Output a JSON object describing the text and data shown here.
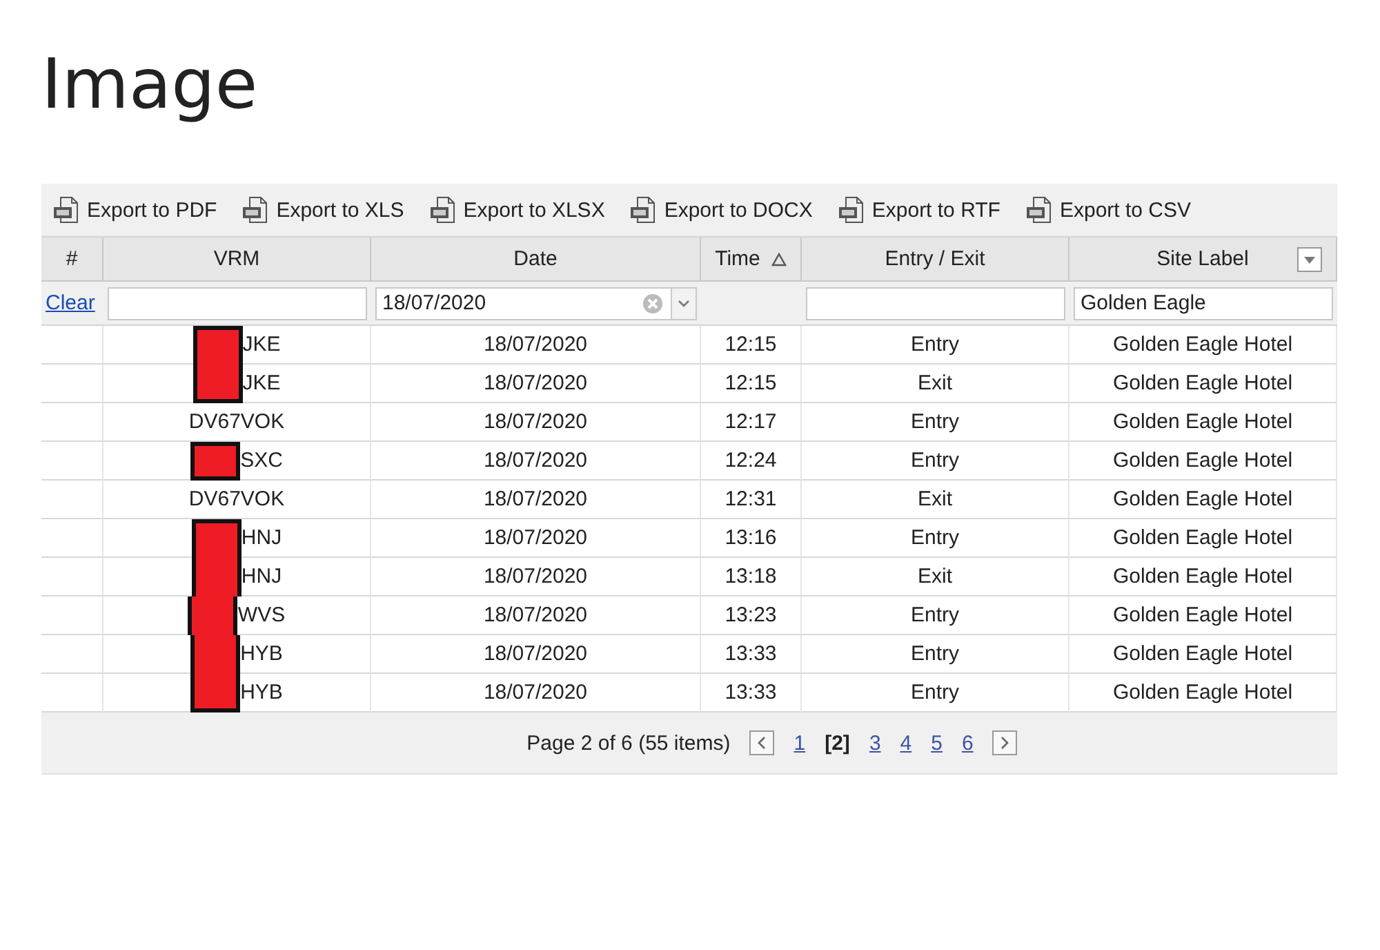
{
  "heading": "Image",
  "toolbar": [
    {
      "label": "Export to PDF"
    },
    {
      "label": "Export to XLS"
    },
    {
      "label": "Export to XLSX"
    },
    {
      "label": "Export to DOCX"
    },
    {
      "label": "Export to RTF"
    },
    {
      "label": "Export to CSV"
    }
  ],
  "columns": [
    {
      "label": "#"
    },
    {
      "label": "VRM"
    },
    {
      "label": "Date"
    },
    {
      "label": "Time",
      "sorted_ascending": true
    },
    {
      "label": "Entry / Exit"
    },
    {
      "label": "Site Label",
      "filter_menu": true
    }
  ],
  "filter_row": {
    "clear": "Clear",
    "date": "18/07/2020",
    "site_label": "Golden Eagle"
  },
  "rows": [
    {
      "vrm": "JKE",
      "redacted": true,
      "date": "18/07/2020",
      "time": "12:15",
      "entry_exit": "Entry",
      "site_label": "Golden Eagle Hotel"
    },
    {
      "vrm": "JKE",
      "redacted": true,
      "date": "18/07/2020",
      "time": "12:15",
      "entry_exit": "Exit",
      "site_label": "Golden Eagle Hotel"
    },
    {
      "vrm": "DV67VOK",
      "redacted": false,
      "date": "18/07/2020",
      "time": "12:17",
      "entry_exit": "Entry",
      "site_label": "Golden Eagle Hotel"
    },
    {
      "vrm": "SXC",
      "redacted": true,
      "date": "18/07/2020",
      "time": "12:24",
      "entry_exit": "Entry",
      "site_label": "Golden Eagle Hotel"
    },
    {
      "vrm": "DV67VOK",
      "redacted": false,
      "date": "18/07/2020",
      "time": "12:31",
      "entry_exit": "Exit",
      "site_label": "Golden Eagle Hotel"
    },
    {
      "vrm": "HNJ",
      "redacted": true,
      "date": "18/07/2020",
      "time": "13:16",
      "entry_exit": "Entry",
      "site_label": "Golden Eagle Hotel"
    },
    {
      "vrm": "HNJ",
      "redacted": true,
      "date": "18/07/2020",
      "time": "13:18",
      "entry_exit": "Exit",
      "site_label": "Golden Eagle Hotel"
    },
    {
      "vrm": "WVS",
      "redacted": true,
      "date": "18/07/2020",
      "time": "13:23",
      "entry_exit": "Entry",
      "site_label": "Golden Eagle Hotel"
    },
    {
      "vrm": "HYB",
      "redacted": true,
      "date": "18/07/2020",
      "time": "13:33",
      "entry_exit": "Entry",
      "site_label": "Golden Eagle Hotel"
    },
    {
      "vrm": "HYB",
      "redacted": true,
      "date": "18/07/2020",
      "time": "13:33",
      "entry_exit": "Entry",
      "site_label": "Golden Eagle Hotel"
    }
  ],
  "pager": {
    "summary": "Page 2 of 6 (55 items)",
    "pages": [
      {
        "label": "1",
        "selected": false
      },
      {
        "label": "[2]",
        "selected": true
      },
      {
        "label": "3",
        "selected": false
      },
      {
        "label": "4",
        "selected": false
      },
      {
        "label": "5",
        "selected": false
      },
      {
        "label": "6",
        "selected": false
      }
    ]
  }
}
